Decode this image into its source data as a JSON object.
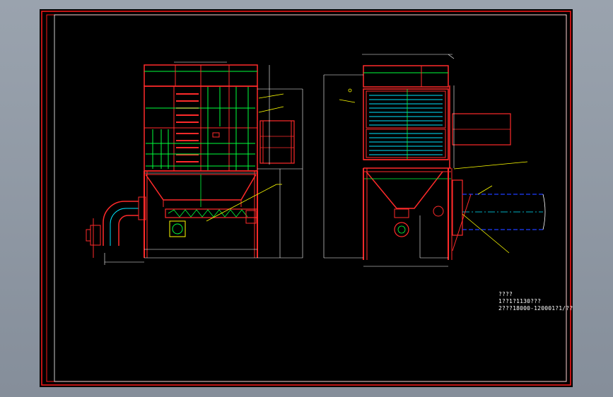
{
  "viewport": {
    "background": "#8e97a3"
  },
  "drawing": {
    "background": "#000000",
    "colors": {
      "border": "#ff0000",
      "frame": "#ff2a2a",
      "internal": "#00ff3c",
      "dimension": "#ffffff",
      "leader": "#ffff00",
      "duct": "#1e3cff",
      "pipe": "#00e5ff",
      "axis": "#00ff3c"
    },
    "title_label": "????",
    "notes": [
      "1??1?1130???",
      "2???18000-120001?1/??"
    ]
  }
}
